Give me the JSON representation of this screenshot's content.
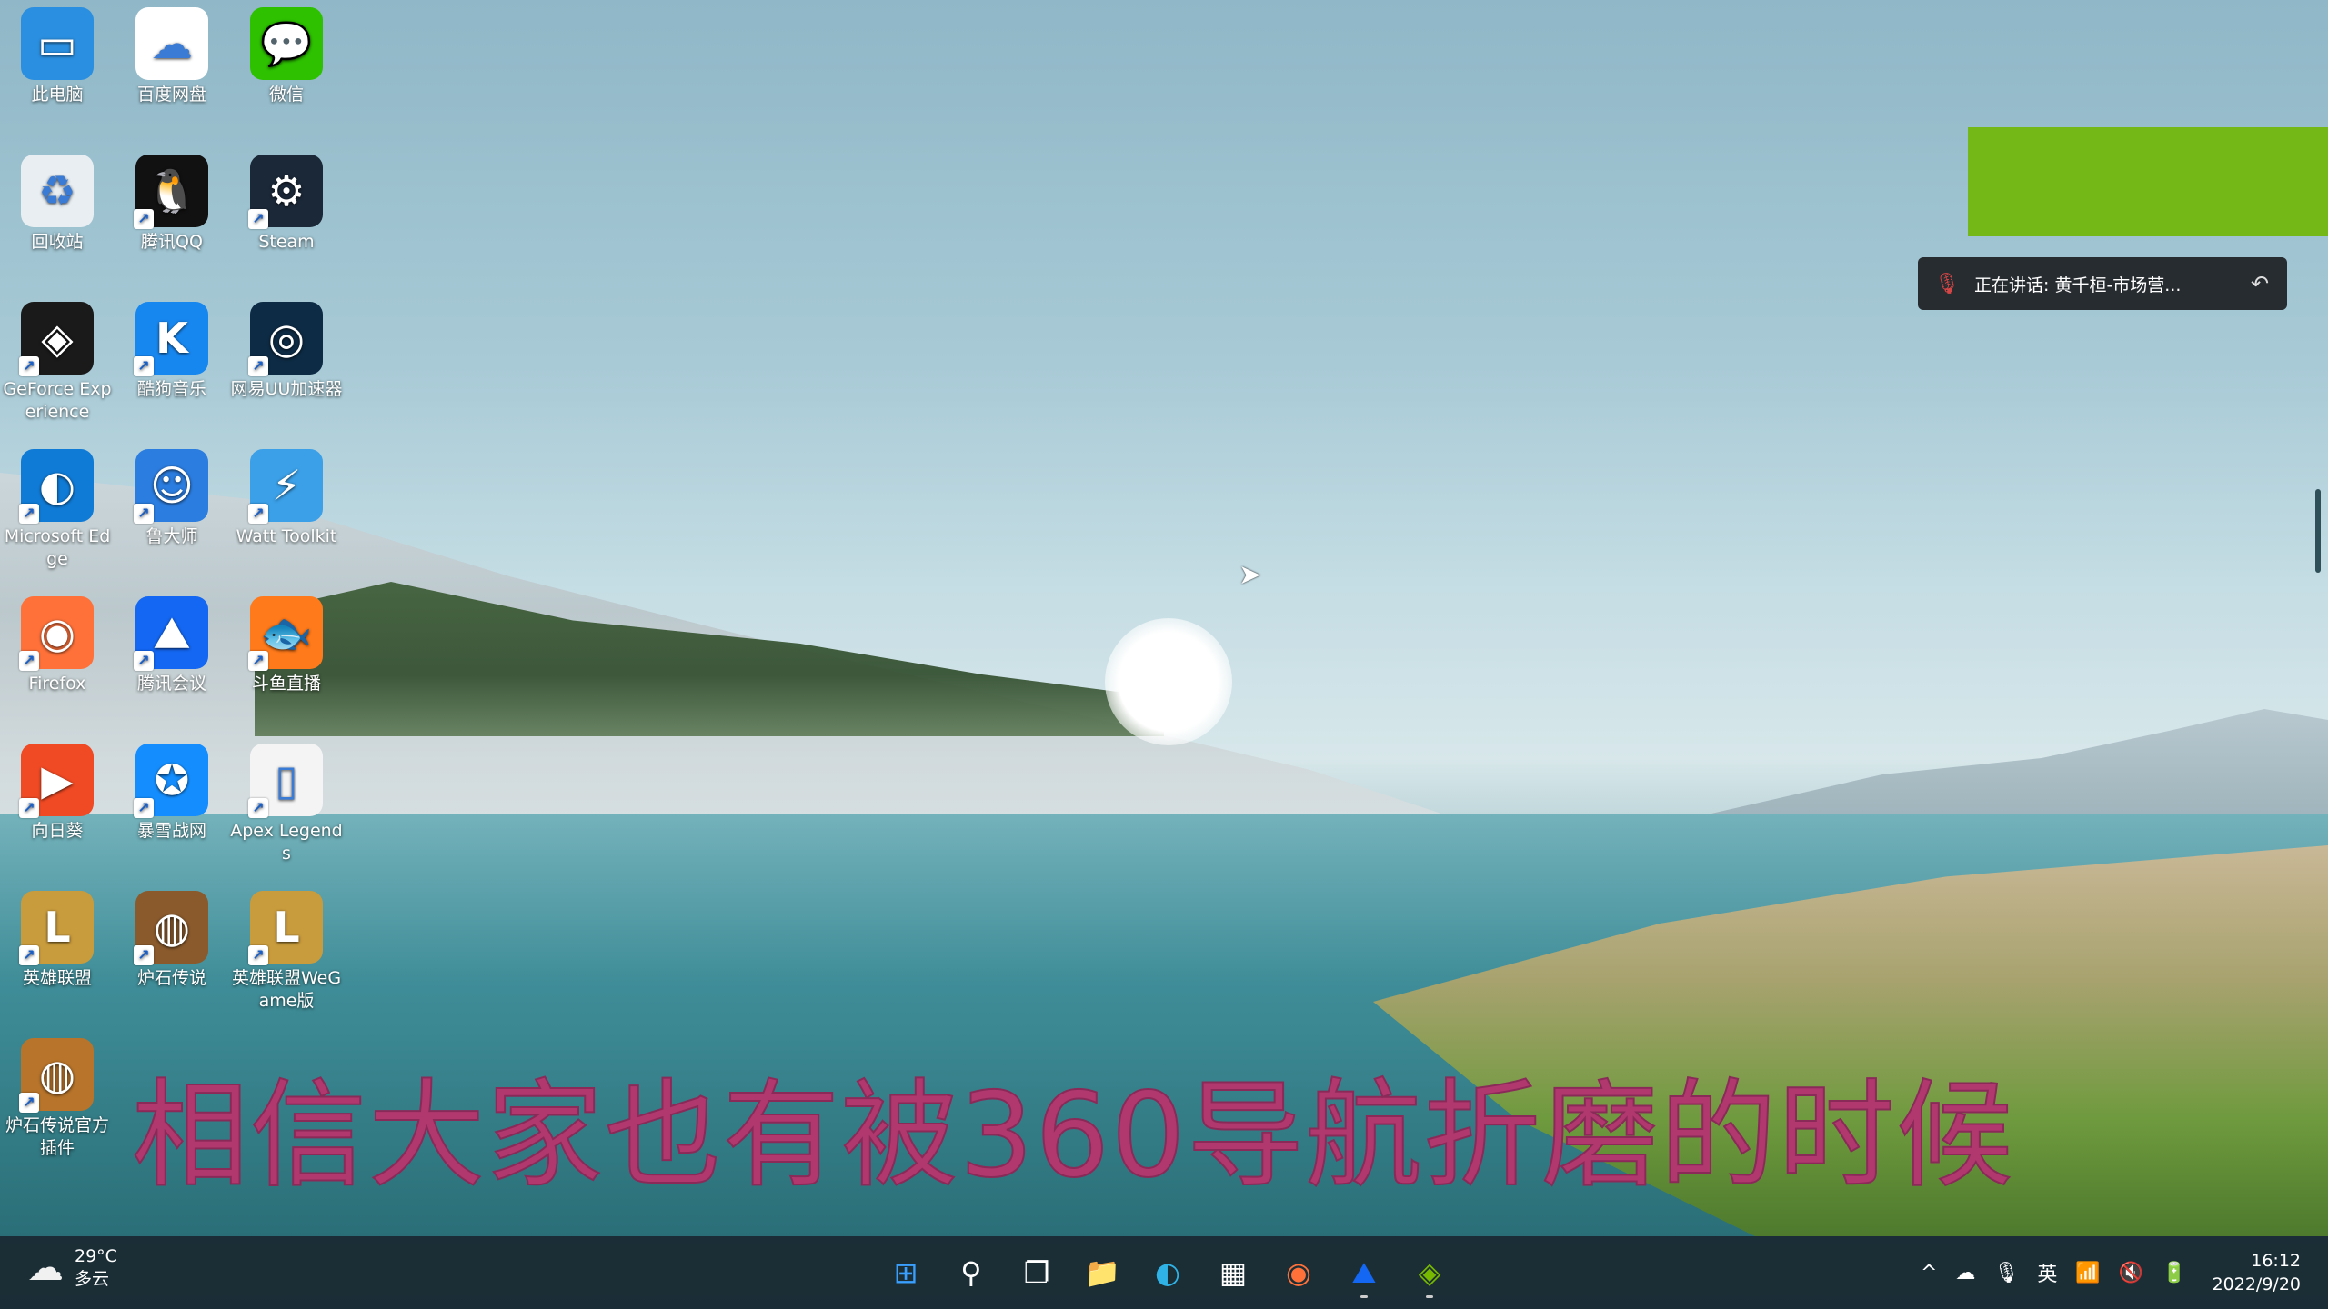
{
  "desktop": {
    "icons": [
      {
        "label": "此电脑",
        "icon": "computer-icon",
        "color": "#2a8fe0"
      },
      {
        "label": "百度网盘",
        "icon": "baidu-netdisk-icon",
        "color": "#ffffff"
      },
      {
        "label": "微信",
        "icon": "wechat-icon",
        "color": "#2dc100"
      },
      {
        "label": "回收站",
        "icon": "recycle-bin-icon",
        "color": "#e8eef2"
      },
      {
        "label": "腾讯QQ",
        "icon": "qq-penguin-icon",
        "color": "#111111"
      },
      {
        "label": "Steam",
        "icon": "steam-icon",
        "color": "#1b2838"
      },
      {
        "label": "GeForce Experience",
        "icon": "nvidia-icon",
        "color": "#1a1a1a"
      },
      {
        "label": "酷狗音乐",
        "icon": "kugou-icon",
        "color": "#1787f0"
      },
      {
        "label": "网易UU加速器",
        "icon": "uu-accelerator-icon",
        "color": "#0d2b45"
      },
      {
        "label": "Microsoft Edge",
        "icon": "edge-icon",
        "color": "#0f7bd6"
      },
      {
        "label": "鲁大师",
        "icon": "ludashi-icon",
        "color": "#2b7de0"
      },
      {
        "label": "Watt Toolkit",
        "icon": "watt-toolkit-icon",
        "color": "#3ba0e8"
      },
      {
        "label": "Firefox",
        "icon": "firefox-icon",
        "color": "#ff7139"
      },
      {
        "label": "腾讯会议",
        "icon": "tencent-meeting-icon",
        "color": "#1467f2"
      },
      {
        "label": "斗鱼直播",
        "icon": "douyu-icon",
        "color": "#ff7a1a"
      },
      {
        "label": "向日葵",
        "icon": "sunlogin-icon",
        "color": "#f04a24"
      },
      {
        "label": "暴雪战网",
        "icon": "battlenet-icon",
        "color": "#148eff"
      },
      {
        "label": "Apex Legends",
        "icon": "file-icon",
        "color": "#f4f4f4"
      },
      {
        "label": "英雄联盟",
        "icon": "league-of-legends-icon",
        "color": "#c89b3c"
      },
      {
        "label": "炉石传说",
        "icon": "hearthstone-icon",
        "color": "#8a5a2c"
      },
      {
        "label": "英雄联盟WeGame版",
        "icon": "league-of-legends-icon",
        "color": "#c89b3c"
      },
      {
        "label": "炉石传说官方插件",
        "icon": "hearthstone-plugin-icon",
        "color": "#b7742a"
      }
    ]
  },
  "overlay": {
    "speaking_text": "正在讲话: 黄千桓-市场营...",
    "subtitle": "相信大家也有被360导航折磨的时候"
  },
  "taskbar": {
    "weather_temp": "29°C",
    "weather_desc": "多云",
    "apps": [
      {
        "name": "start-button",
        "glyph": "⊞",
        "color": "#3aa0ff"
      },
      {
        "name": "search-button",
        "glyph": "⚲",
        "color": "#ffffff"
      },
      {
        "name": "task-view-button",
        "glyph": "❐",
        "color": "#ffffff"
      },
      {
        "name": "file-explorer-button",
        "glyph": "📁",
        "color": "#f5c542"
      },
      {
        "name": "edge-button",
        "glyph": "◐",
        "color": "#2fb3e6"
      },
      {
        "name": "store-button",
        "glyph": "▦",
        "color": "#ffffff"
      },
      {
        "name": "firefox-button",
        "glyph": "◉",
        "color": "#ff7139"
      },
      {
        "name": "tencent-meeting-button",
        "glyph": "⛰",
        "color": "#1467f2"
      },
      {
        "name": "nvidia-button",
        "glyph": "◈",
        "color": "#76b900"
      }
    ],
    "tray": {
      "chevron": "^",
      "cloud": "☁",
      "mic": "🎙",
      "ime": "英",
      "wifi": "📶",
      "volume": "🔇",
      "battery": "🔋"
    },
    "time": "16:12",
    "date": "2022/9/20"
  }
}
